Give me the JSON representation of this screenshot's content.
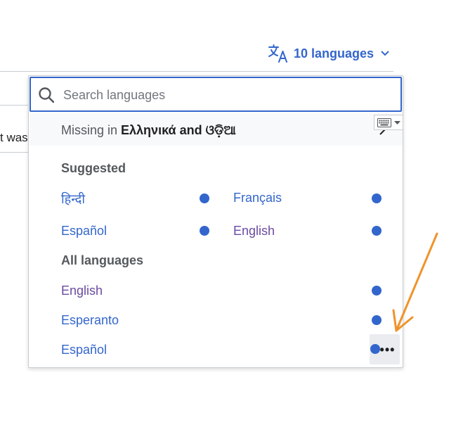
{
  "page": {
    "partial_text": "t was"
  },
  "language_button": {
    "label": "10 languages",
    "icon": "translate-icon",
    "chevron_icon": "chevron-down-icon",
    "color": "#3366cc"
  },
  "search": {
    "placeholder": "Search languages",
    "value": "",
    "icon": "search-icon"
  },
  "missing": {
    "prefix": "Missing in ",
    "languages": "Ελληνικά and ଓଡ଼ିଆ",
    "icon": "chevron-right-icon"
  },
  "keyboard": {
    "icon": "keyboard-icon",
    "dropdown_icon": "caret-down-icon"
  },
  "suggested": {
    "heading": "Suggested",
    "items": [
      {
        "label": "हिन्दी",
        "visited": false
      },
      {
        "label": "Français",
        "visited": false
      },
      {
        "label": "Español",
        "visited": false
      },
      {
        "label": "English",
        "visited": true
      }
    ]
  },
  "all_languages": {
    "heading": "All languages",
    "items": [
      {
        "label": "English",
        "visited": true
      },
      {
        "label": "Esperanto",
        "visited": false
      },
      {
        "label": "Español",
        "visited": false
      }
    ]
  },
  "more_button": {
    "label": "•••",
    "icon": "ellipsis-icon"
  },
  "colors": {
    "accent": "#3366cc",
    "visited": "#6b4ba1",
    "annotation_arrow": "#f0932b"
  }
}
